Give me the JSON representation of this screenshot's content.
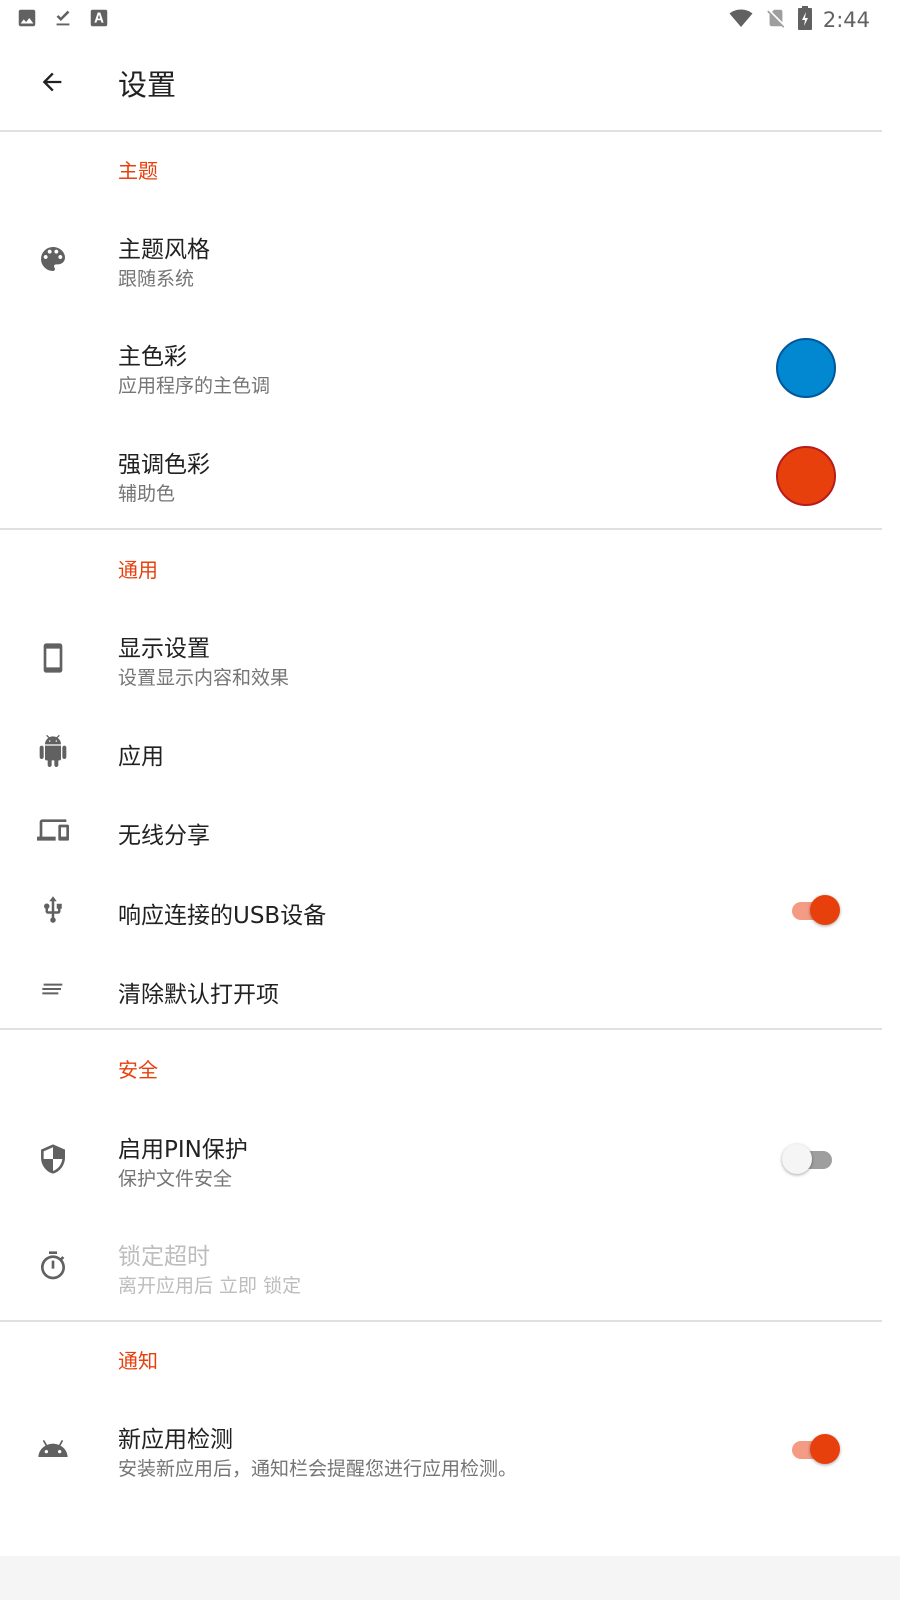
{
  "status_bar": {
    "time": "2:44"
  },
  "app_bar": {
    "title": "设置"
  },
  "sections": {
    "theme": {
      "header": "主题",
      "theme_style": {
        "title": "主题风格",
        "subtitle": "跟随系统"
      },
      "primary_color": {
        "title": "主色彩",
        "subtitle": "应用程序的主色调",
        "color": "#0288d1"
      },
      "accent_color": {
        "title": "强调色彩",
        "subtitle": "辅助色",
        "color": "#e8400c"
      }
    },
    "general": {
      "header": "通用",
      "display": {
        "title": "显示设置",
        "subtitle": "设置显示内容和效果"
      },
      "apps": {
        "title": "应用"
      },
      "wireless_share": {
        "title": "无线分享"
      },
      "usb": {
        "title": "响应连接的USB设备",
        "enabled": true
      },
      "clear_defaults": {
        "title": "清除默认打开项"
      }
    },
    "security": {
      "header": "安全",
      "pin": {
        "title": "启用PIN保护",
        "subtitle": "保护文件安全",
        "enabled": false
      },
      "lock_timeout": {
        "title": "锁定超时",
        "subtitle": "离开应用后 立即 锁定"
      }
    },
    "notification": {
      "header": "通知",
      "new_app_detect": {
        "title": "新应用检测",
        "subtitle": "安装新应用后，通知栏会提醒您进行应用检测。",
        "enabled": true
      }
    }
  },
  "colors": {
    "accent": "#e8400c",
    "primary": "#0288d1"
  }
}
